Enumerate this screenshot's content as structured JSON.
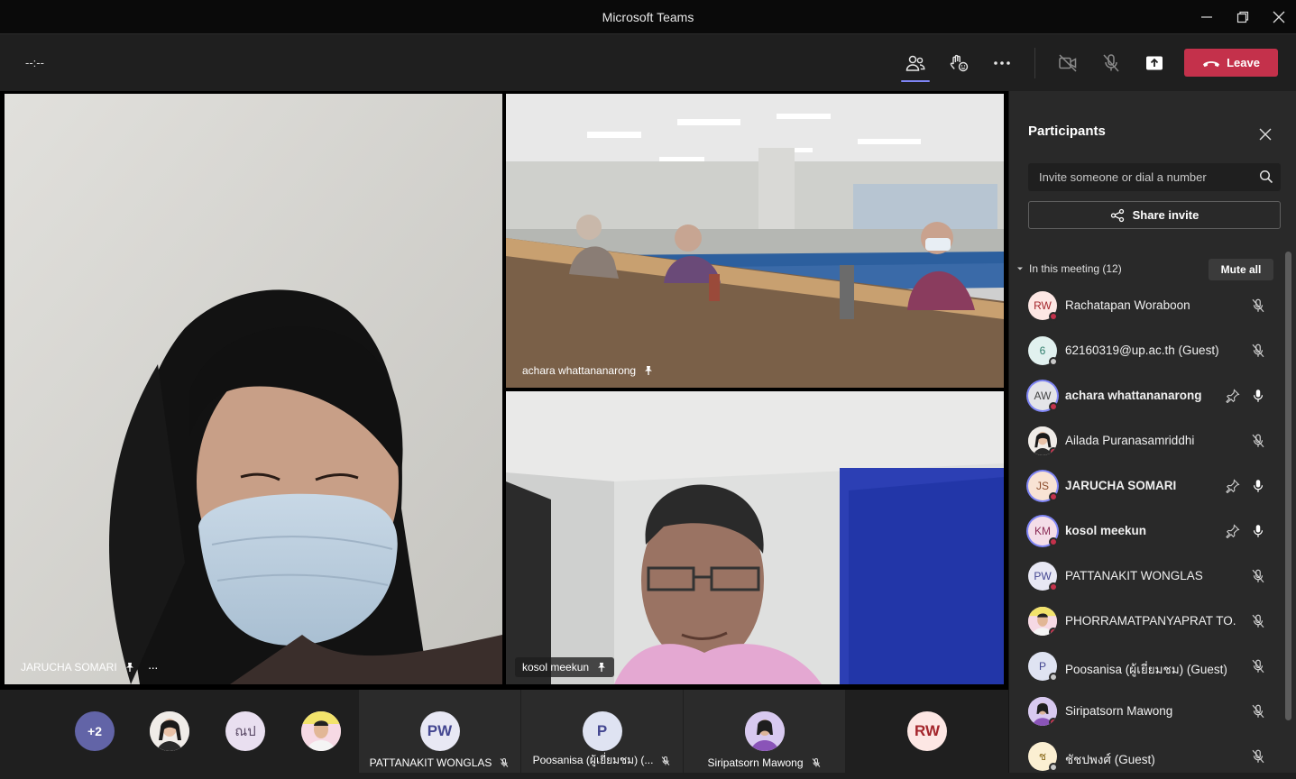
{
  "window": {
    "title": "Microsoft Teams"
  },
  "toolbar": {
    "timer": "--:--",
    "leave_label": "Leave"
  },
  "tiles": {
    "main": {
      "name": "JARUCHA SOMARI",
      "more": "···"
    },
    "top_right": {
      "name": "achara whattananarong"
    },
    "bottom_right": {
      "name": "kosol meekun"
    }
  },
  "strip": {
    "overflow": "+2",
    "chips": [
      {
        "initials": "ณป"
      },
      {
        "initials": "PW",
        "name": "PATTANAKIT WONGLAS"
      },
      {
        "initials": "P",
        "name": "Poosanisa (ผู้เยี่ยมชม) (..."
      },
      {
        "name": "Siripatsorn Mawong"
      },
      {
        "initials": "RW"
      }
    ]
  },
  "panel": {
    "title": "Participants",
    "search_placeholder": "Invite someone or dial a number",
    "share_label": "Share invite",
    "section_label": "In this meeting (12)",
    "mute_all_label": "Mute all",
    "participants": [
      {
        "initials": "RW",
        "name": "Rachatapan Woraboon"
      },
      {
        "initials": "6",
        "name": "62160319@up.ac.th (Guest)"
      },
      {
        "initials": "AW",
        "name": "achara whattananarong"
      },
      {
        "initials": "",
        "name": "Ailada Puranasamriddhi"
      },
      {
        "initials": "JS",
        "name": "JARUCHA SOMARI"
      },
      {
        "initials": "KM",
        "name": "kosol meekun"
      },
      {
        "initials": "PW",
        "name": "PATTANAKIT WONGLAS"
      },
      {
        "initials": "",
        "name": "PHORRAMATPANYAPRAT TO..."
      },
      {
        "initials": "P",
        "name": "Poosanisa (ผู้เยี่ยมชม) (Guest)"
      },
      {
        "initials": "",
        "name": "Siripatsorn Mawong"
      },
      {
        "initials": "ช",
        "name": "ชัชปพงศ์ (Guest)"
      }
    ]
  }
}
